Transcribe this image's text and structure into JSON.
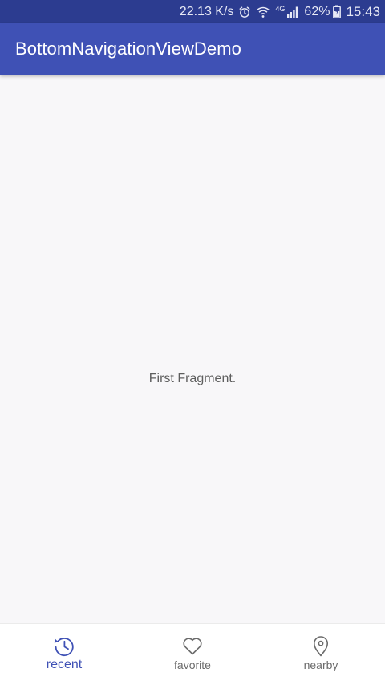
{
  "status_bar": {
    "network_speed": "22.13 K/s",
    "network_type": "4G",
    "battery": "62%",
    "time": "15:43"
  },
  "app_bar": {
    "title": "BottomNavigationViewDemo"
  },
  "content": {
    "message": "First Fragment."
  },
  "bottom_nav": {
    "items": [
      {
        "label": "recent",
        "icon": "history-icon",
        "active": true
      },
      {
        "label": "favorite",
        "icon": "heart-icon",
        "active": false
      },
      {
        "label": "nearby",
        "icon": "location-pin-icon",
        "active": false
      }
    ]
  },
  "colors": {
    "status_bar": "#2c3c90",
    "primary": "#3f51b5",
    "background": "#f8f7f9",
    "inactive": "#6b6b6b"
  }
}
